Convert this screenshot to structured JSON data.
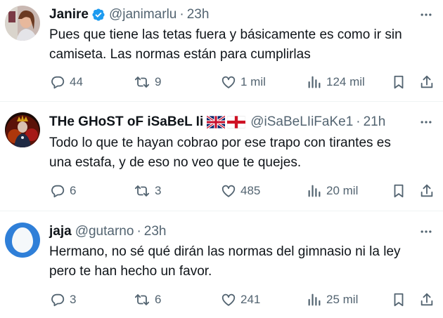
{
  "tweets": [
    {
      "name": "Janire",
      "verified": true,
      "handle": "@janimarlu",
      "separator": "·",
      "time": "23h",
      "text_line1": "Pues que tiene las tetas fuera y básicamente es como ir sin",
      "text_line2": "camiseta. Las normas están para cumplirlas",
      "replies": "44",
      "retweets": "9",
      "likes": "1 mil",
      "views": "124 mil"
    },
    {
      "name": "THe GHoST oF iSaBeL Ii",
      "flags": [
        "uk-flag",
        "england-flag"
      ],
      "handle": "@iSaBeLIiFaKe1",
      "separator": "·",
      "time": "21h",
      "text_line1": "Todo lo que te hayan cobrao por ese trapo con tirantes es",
      "text_line2": "una estafa, y de eso no veo que te quejes.",
      "replies": "6",
      "retweets": "3",
      "likes": "485",
      "views": "20 mil"
    },
    {
      "name": "jaja",
      "handle": "@gutarno",
      "separator": "·",
      "time": "23h",
      "text_line1": "Hermano, no sé qué dirán las normas del gimnasio ni la ley",
      "text_line2": "pero te han hecho un favor.",
      "replies": "3",
      "retweets": "6",
      "likes": "241",
      "views": "25 mil"
    }
  ],
  "colors": {
    "text": "#0f1419",
    "secondary": "#536471",
    "verified": "#1d9bf0",
    "divider": "#eff3f4"
  },
  "icons": [
    "more-icon",
    "reply-icon",
    "retweet-icon",
    "like-icon",
    "views-icon",
    "bookmark-icon",
    "share-icon",
    "verified-badge-icon"
  ]
}
